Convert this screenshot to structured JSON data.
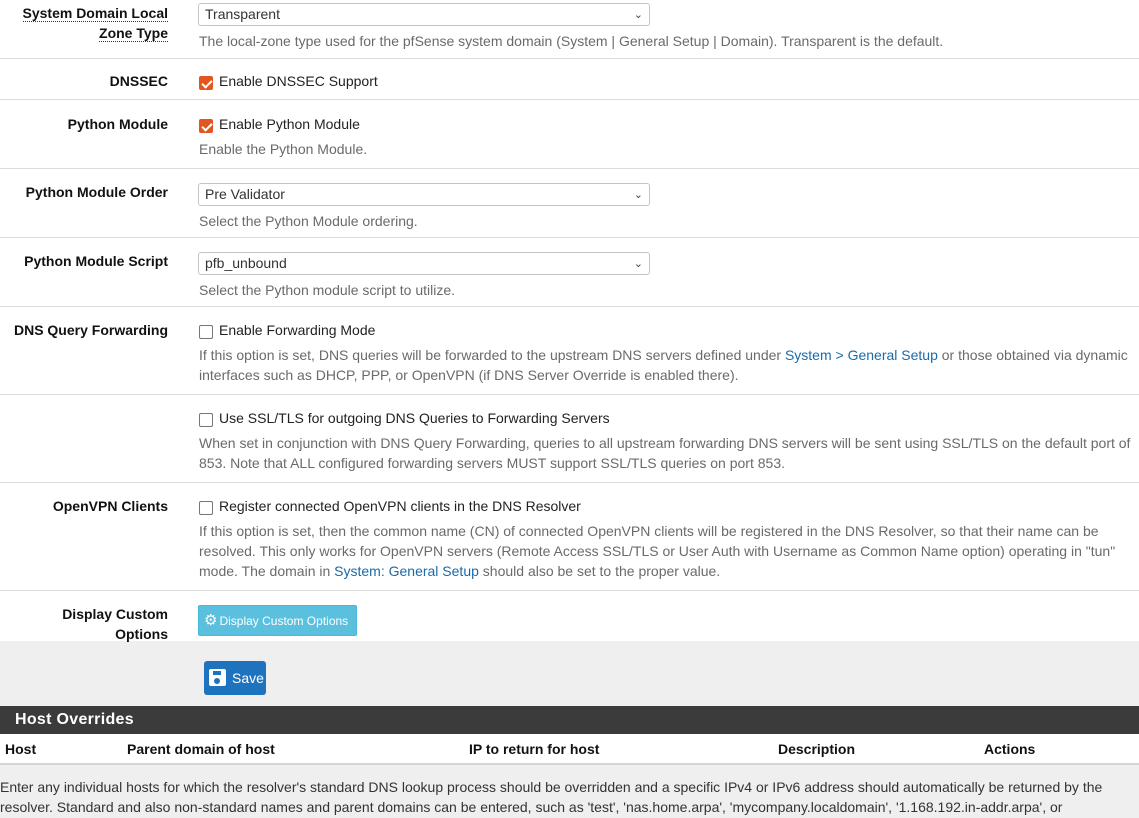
{
  "zone_type": {
    "label": "System Domain Local Zone Type",
    "label_line1": "System Domain Local",
    "label_line2": "Zone Type",
    "value": "Transparent",
    "help": "The local-zone type used for the pfSense system domain (System | General Setup | Domain). Transparent is the default."
  },
  "dnssec": {
    "label": "DNSSEC",
    "checkbox_label": "Enable DNSSEC Support",
    "checked": true
  },
  "python_module": {
    "label": "Python Module",
    "checkbox_label": "Enable Python Module",
    "checked": true,
    "help": "Enable the Python Module."
  },
  "python_order": {
    "label": "Python Module Order",
    "value": "Pre Validator",
    "help": "Select the Python Module ordering."
  },
  "python_script": {
    "label": "Python Module Script",
    "value": "pfb_unbound",
    "help": "Select the Python module script to utilize."
  },
  "forwarding": {
    "label": "DNS Query Forwarding",
    "checkbox_label": "Enable Forwarding Mode",
    "checked": false,
    "help_pre": "If this option is set, DNS queries will be forwarded to the upstream DNS servers defined under ",
    "help_link": "System > General Setup",
    "help_post1": " or those obtained via dynamic",
    "help_line2": "interfaces such as DHCP, PPP, or OpenVPN (if DNS Server Override is enabled there)."
  },
  "ssl_tls": {
    "checkbox_label": "Use SSL/TLS for outgoing DNS Queries to Forwarding Servers",
    "checked": false,
    "help_line1": "When set in conjunction with DNS Query Forwarding, queries to all upstream forwarding DNS servers will be sent using SSL/TLS on the default port of",
    "help_line2": "853. Note that ALL configured forwarding servers MUST support SSL/TLS queries on port 853."
  },
  "openvpn": {
    "label": "OpenVPN Clients",
    "checkbox_label": "Register connected OpenVPN clients in the DNS Resolver",
    "checked": false,
    "help_line1": "If this option is set, then the common name (CN) of connected OpenVPN clients will be registered in the DNS Resolver, so that their name can be",
    "help_line2": "resolved. This only works for OpenVPN servers (Remote Access SSL/TLS or User Auth with Username as Common Name option) operating in \"tun\"",
    "help_line3_pre": "mode. The domain in ",
    "help_line3_link": "System: General Setup",
    "help_line3_post": " should also be set to the proper value."
  },
  "custom_options": {
    "label": "Display Custom Options",
    "button_label": "Display Custom Options",
    "icon": "gear-icon"
  },
  "save": {
    "label": "Save",
    "icon": "floppy-icon"
  },
  "host_overrides": {
    "title": "Host Overrides",
    "columns": [
      "Host",
      "Parent domain of host",
      "IP to return for host",
      "Description",
      "Actions"
    ],
    "footer_line1": "Enter any individual hosts for which the resolver's standard DNS lookup process should be overridden and a specific IPv4 or IPv6 address should automatically be returned by the",
    "footer_line2": "resolver. Standard and also non-standard names and parent domains can be entered, such as 'test', 'nas.home.arpa', 'mycompany.localdomain', '1.168.192.in-addr.arpa', or"
  },
  "colors": {
    "checkbox_checked": "#e2571e",
    "info_button": "#5bc0de",
    "primary_button": "#1e73be",
    "link": "#1a6aa8",
    "section_header": "#3b3b3b"
  }
}
